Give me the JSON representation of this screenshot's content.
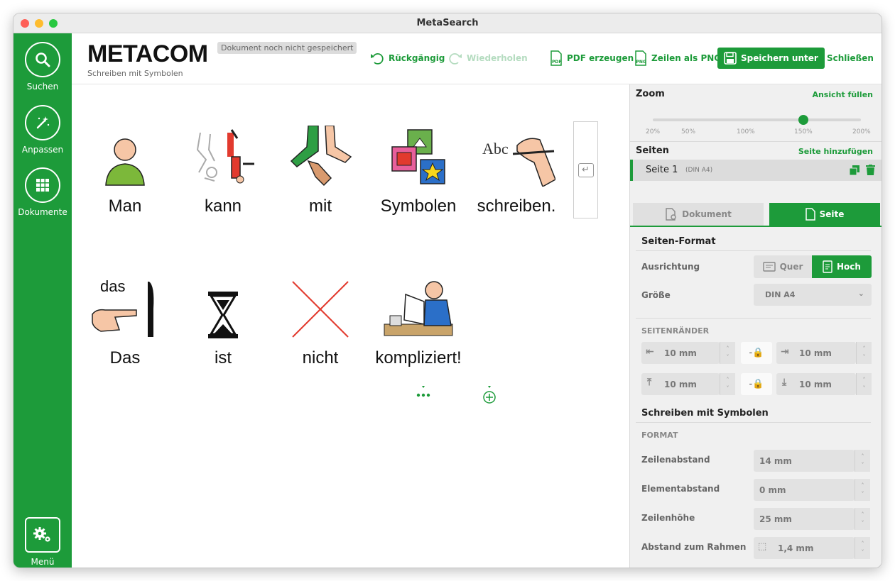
{
  "window": {
    "title": "MetaSearch"
  },
  "sidebar": {
    "items": [
      {
        "label": "Suchen",
        "icon": "search-icon"
      },
      {
        "label": "Anpassen",
        "icon": "magic-wand-icon"
      },
      {
        "label": "Dokumente",
        "icon": "grid-icon"
      }
    ],
    "menu": {
      "label": "Menü",
      "icon": "gears-icon"
    }
  },
  "header": {
    "logo": "METACOM",
    "subtitle": "Schreiben mit Symbolen",
    "status": "Dokument noch nicht gespeichert",
    "undo": "Rückgängig",
    "redo": "Wiederholen",
    "pdf": "PDF erzeugen",
    "png": "Zeilen als PNG",
    "save_as": "Speichern unter",
    "close": "Schließen"
  },
  "document": {
    "line1": [
      {
        "word": "Man",
        "icon": "person-icon"
      },
      {
        "word": "kann",
        "icon": "gymnast-icon"
      },
      {
        "word": "mit",
        "icon": "feet-icon"
      },
      {
        "word": "Symbolen",
        "icon": "symbols-icon"
      },
      {
        "word": "schreiben.",
        "icon": "writing-hand-icon",
        "caption": "Abc"
      }
    ],
    "line2": [
      {
        "word": "Das",
        "icon": "pointing-knife-icon",
        "caption": "das"
      },
      {
        "word": "ist",
        "icon": "hourglass-icon"
      },
      {
        "word": "nicht",
        "icon": "cross-icon"
      },
      {
        "word": "kompliziert!",
        "icon": "thinking-man-icon"
      }
    ]
  },
  "panel": {
    "zoom": {
      "label": "Zoom",
      "fill_view": "Ansicht füllen",
      "value_percent": 150,
      "ticks": [
        "20%",
        "50%",
        "100%",
        "150%",
        "200%"
      ]
    },
    "pages": {
      "label": "Seiten",
      "add": "Seite hinzufügen",
      "page_name": "Seite 1",
      "page_format": "(DIN A4)"
    },
    "tabs": {
      "document": "Dokument",
      "page": "Seite"
    },
    "page_format": {
      "title": "Seiten-Format",
      "orientation_label": "Ausrichtung",
      "landscape": "Quer",
      "portrait": "Hoch",
      "size_label": "Größe",
      "size_value": "DIN A4"
    },
    "margins": {
      "title": "SEITENRÄNDER",
      "left": "10 mm",
      "right": "10 mm",
      "top": "10 mm",
      "bottom": "10 mm"
    },
    "writing": {
      "title": "Schreiben mit Symbolen",
      "format_title": "FORMAT",
      "line_spacing_label": "Zeilenabstand",
      "line_spacing": "14 mm",
      "element_spacing_label": "Elementabstand",
      "element_spacing": "0 mm",
      "line_height_label": "Zeilenhöhe",
      "line_height": "25 mm",
      "frame_distance_label": "Abstand zum Rahmen",
      "frame_distance": "1,4 mm"
    }
  },
  "colors": {
    "accent": "#1d9b3a"
  }
}
